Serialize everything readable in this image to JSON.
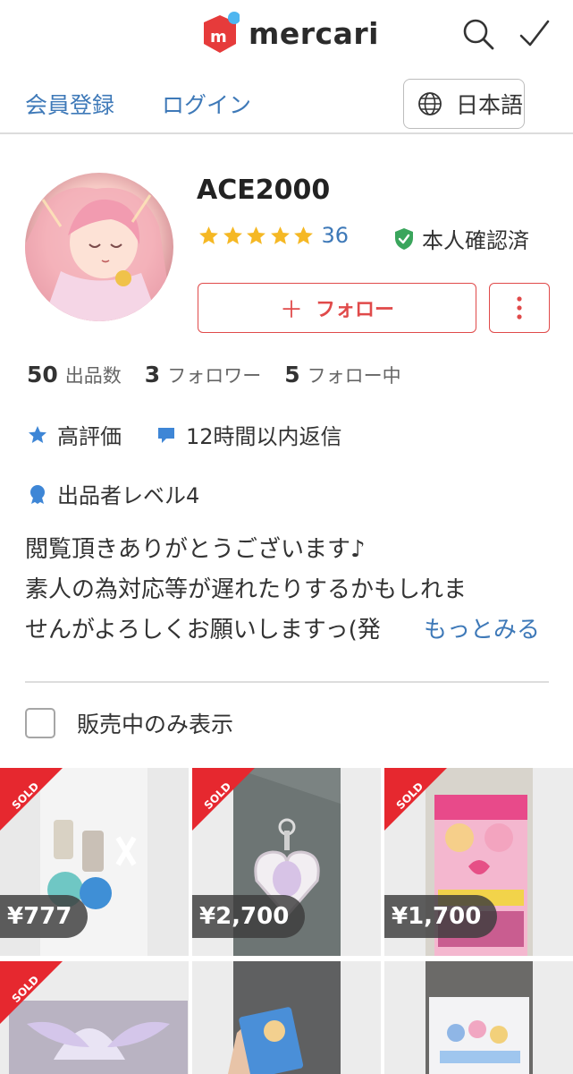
{
  "header": {
    "brand": "mercari",
    "search_icon": "search-icon",
    "check_icon": "checkmark-icon"
  },
  "auth": {
    "register": "会員登録",
    "login": "ログイン",
    "language": "日本語"
  },
  "profile": {
    "username": "ACE2000",
    "rating_stars": 5,
    "rating_count": "36",
    "verified_label": "本人確認済",
    "follow_plus": "＋",
    "follow_label": "フォロー",
    "stats": [
      {
        "num": "50",
        "label": "出品数"
      },
      {
        "num": "3",
        "label": "フォロワー"
      },
      {
        "num": "5",
        "label": "フォロー中"
      }
    ],
    "badges": {
      "rating": "高評価",
      "reply": "12時間以内返信",
      "level": "出品者レベル4"
    },
    "bio_lines": [
      "閲覧頂きありがとうございます♪",
      "素人の為対応等が遅れたりするかもしれま",
      "せんがよろしくお願いしますっ(発"
    ],
    "bio_more": "もっとみる"
  },
  "filter": {
    "label": "販売中のみ表示",
    "checked": false
  },
  "items": [
    {
      "sold": "SOLD",
      "price": "¥777"
    },
    {
      "sold": "SOLD",
      "price": "¥2,700"
    },
    {
      "sold": "SOLD",
      "price": "¥1,700"
    },
    {
      "sold": "SOLD",
      "price": ""
    },
    {
      "sold": "",
      "price": ""
    },
    {
      "sold": "",
      "price": ""
    }
  ],
  "colors": {
    "brand_red": "#e04a4a",
    "link_blue": "#3e79b8",
    "star_yellow": "#f5b824",
    "verified_green": "#3aa55c"
  }
}
